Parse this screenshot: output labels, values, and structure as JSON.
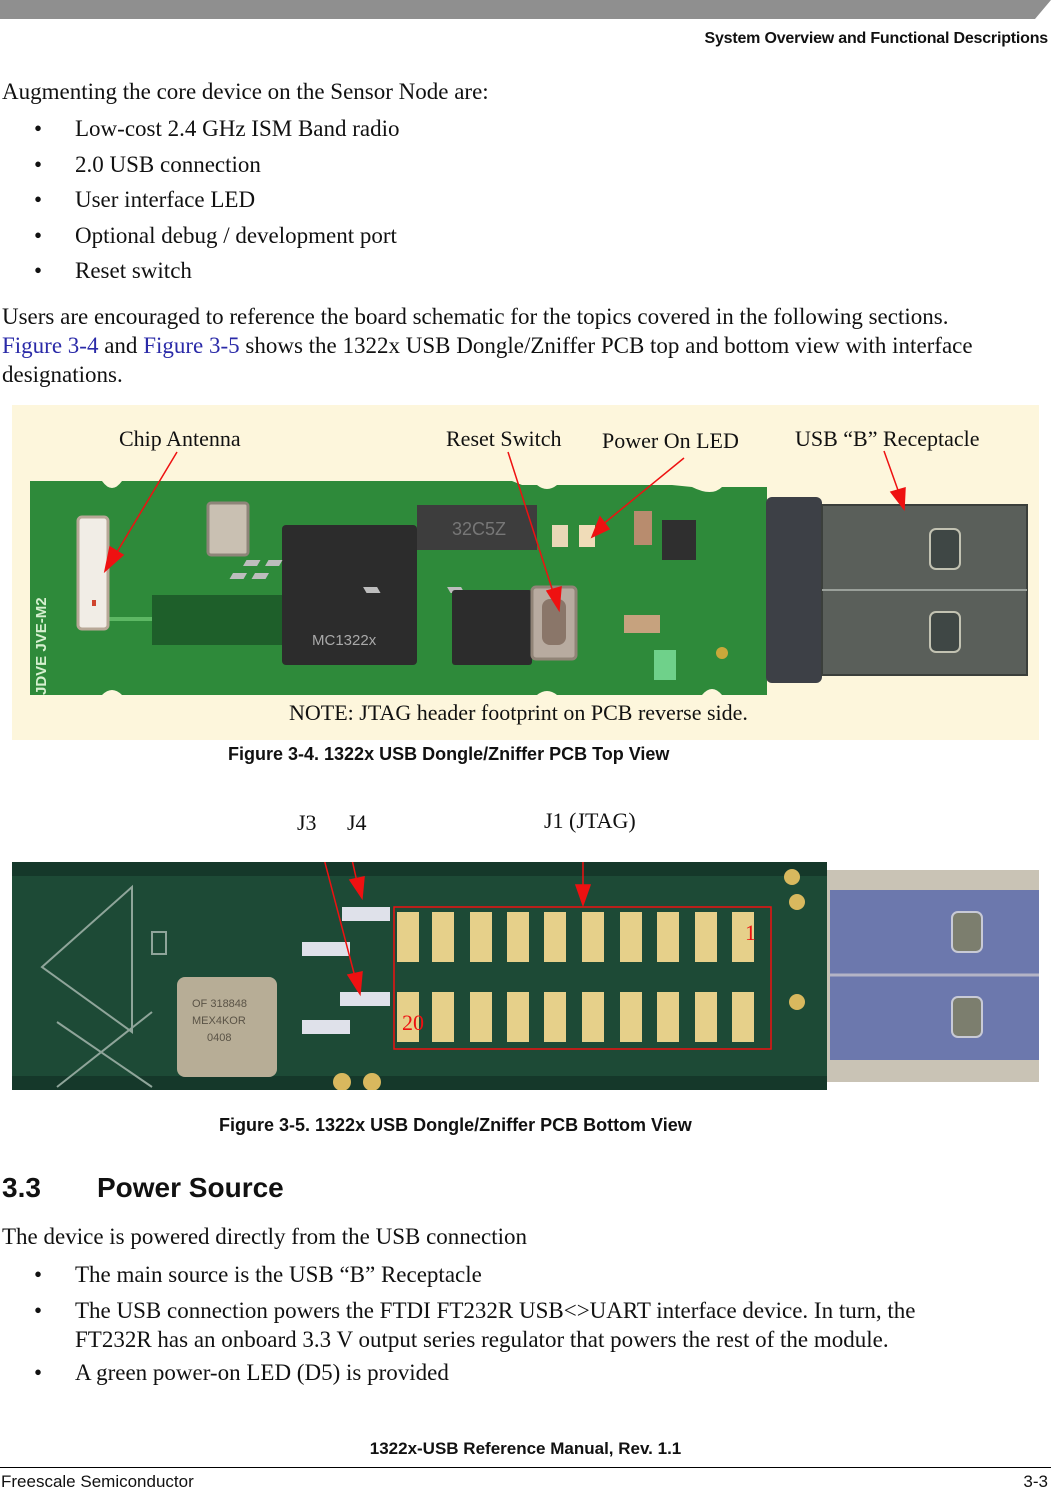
{
  "header": {
    "running_title": "System Overview and Functional Descriptions",
    "bar_color": "#8f8f8f"
  },
  "intro": {
    "lead": "Augmenting the core device on the Sensor Node are:",
    "bullets": [
      "Low-cost 2.4 GHz ISM Band radio",
      "2.0 USB connection",
      "User interface LED",
      "Optional debug / development port",
      "Reset switch"
    ],
    "bullet_glyph": "•"
  },
  "reference_para": {
    "line1": "Users are encouraged to reference the board schematic for the topics covered in the following sections.",
    "link1": "Figure 3-4",
    "and": " and ",
    "link2": "Figure 3-5",
    "line2_rest": " shows the 1322x USB Dongle/Zniffer PCB top and bottom view with interface",
    "line3": "designations."
  },
  "figure_top": {
    "callouts": {
      "chip_antenna": "Chip Antenna",
      "reset_switch": "Reset Switch",
      "power_led": "Power On LED",
      "usb_receptacle": "USB “B” Receptacle"
    },
    "note": "NOTE: JTAG header footprint on PCB reverse side.",
    "chip_marking": "MC1322x",
    "caption": "Figure 3-4. 1322x USB Dongle/Zniffer PCB Top View",
    "annotation_color": "#ee1111"
  },
  "figure_bottom": {
    "callouts": {
      "j3": "J3",
      "j4": "J4",
      "j1": "J1 (JTAG)"
    },
    "pin_first": "1",
    "pin_last": "20",
    "caption": "Figure 3-5. 1322x USB Dongle/Zniffer PCB Bottom View"
  },
  "section": {
    "number": "3.3",
    "title": "Power Source",
    "lead": "The device is powered directly from the USB connection",
    "bullets": [
      "The main source is the USB “B” Receptacle",
      "The USB connection powers the FTDI FT232R USB<>UART interface device. In turn, the",
      "FT232R has an onboard 3.3 V output series regulator that powers the rest of the module.",
      "A green power-on LED (D5) is provided"
    ]
  },
  "footer": {
    "manual_title": "1322x-USB Reference Manual, Rev. 1.1",
    "company": "Freescale Semiconductor",
    "page": "3-3"
  }
}
